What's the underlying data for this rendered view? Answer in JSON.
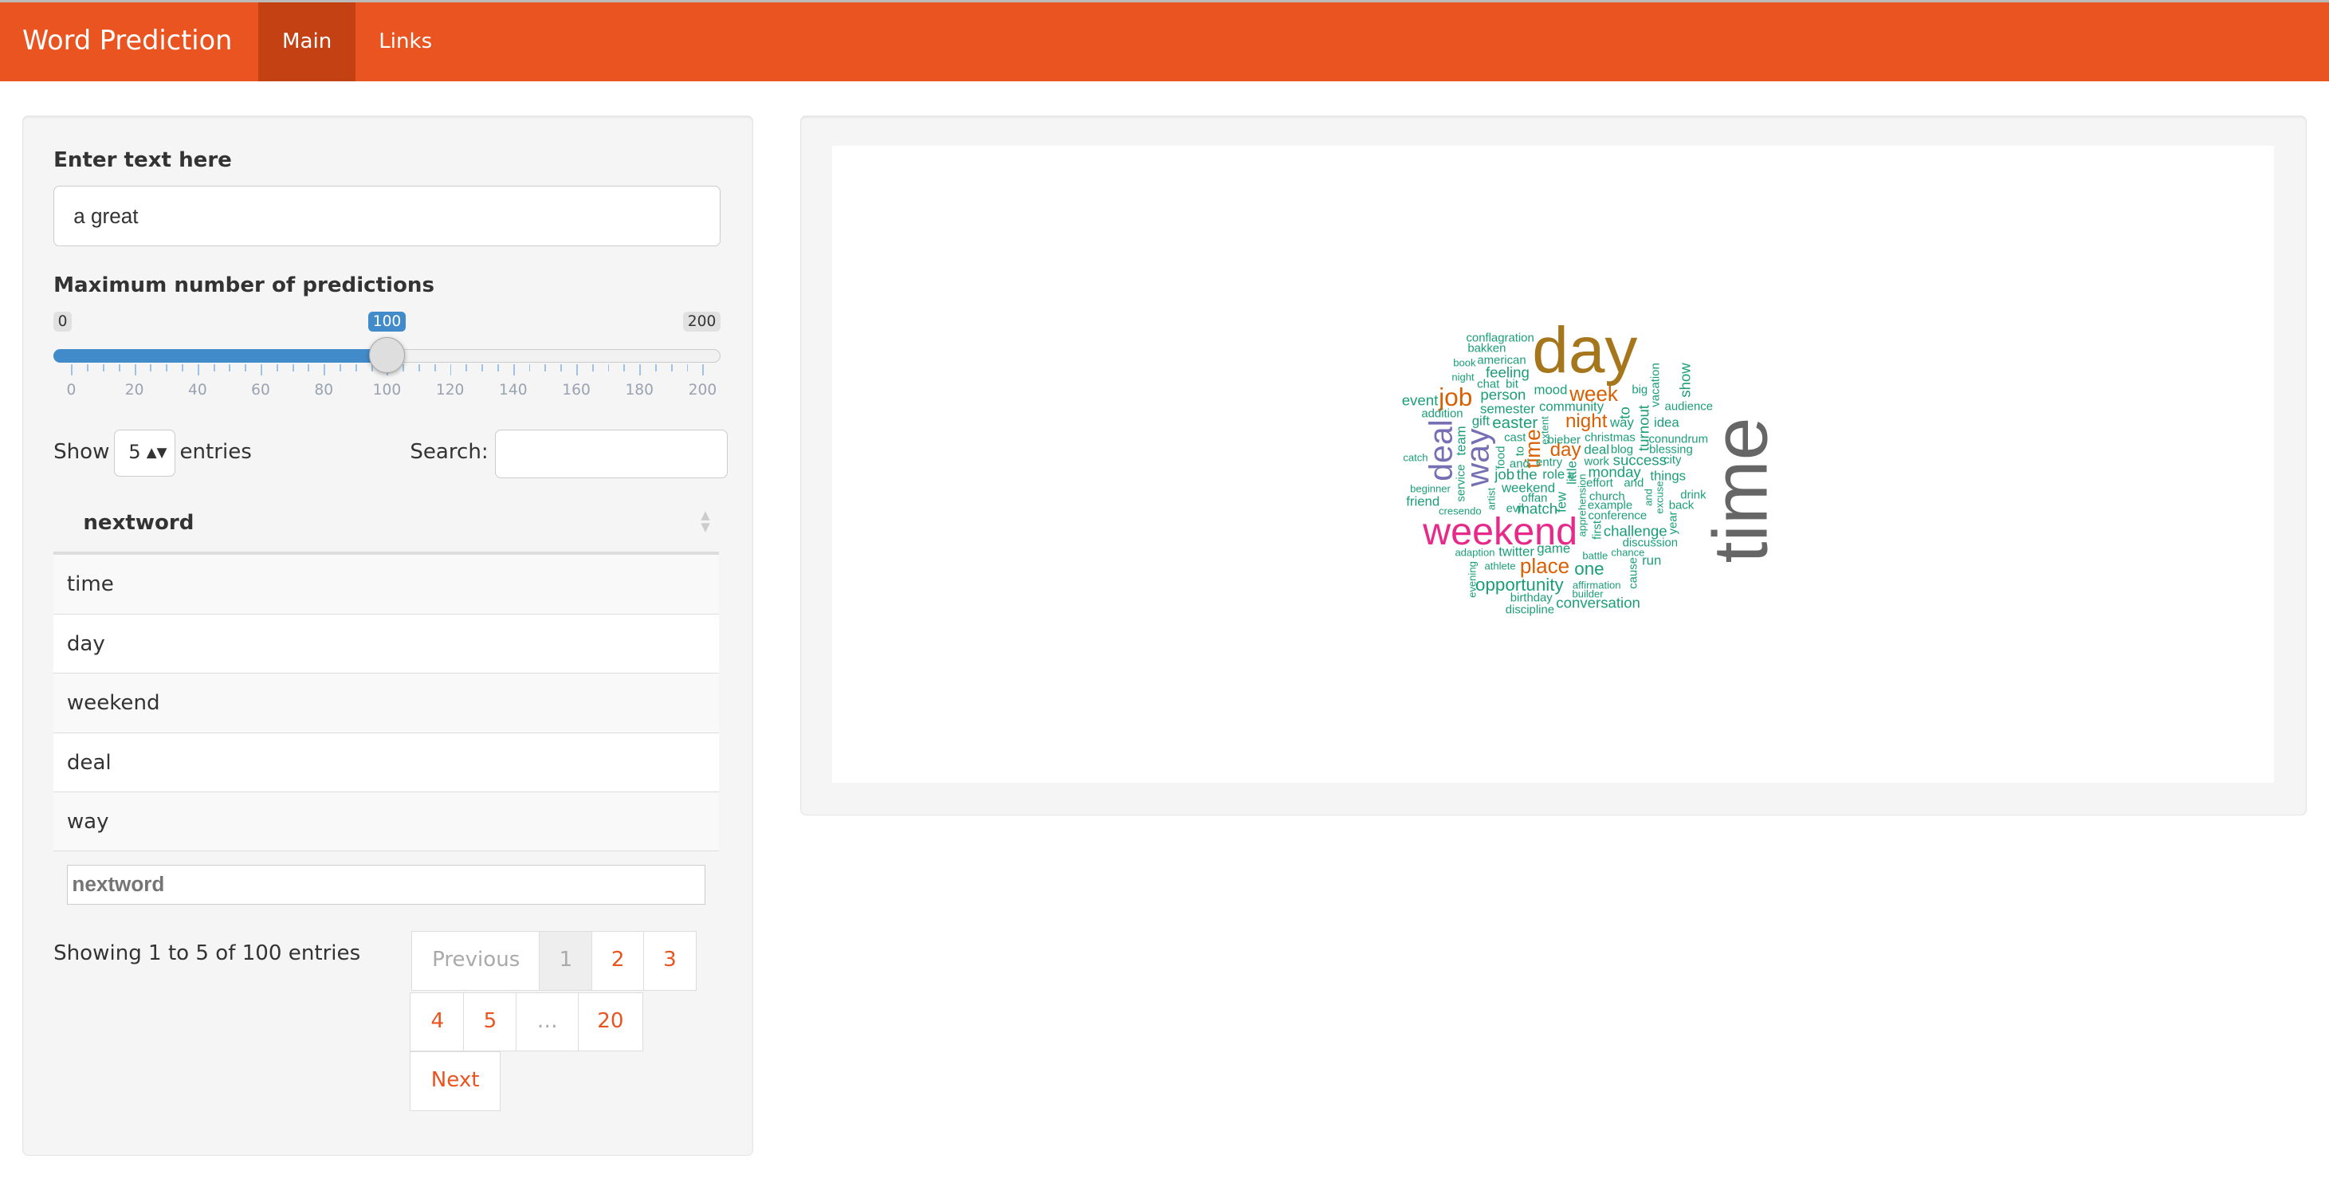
{
  "navbar": {
    "brand": "Word Prediction",
    "tabs": [
      {
        "label": "Main",
        "active": true
      },
      {
        "label": "Links",
        "active": false
      }
    ]
  },
  "input": {
    "label": "Enter text here",
    "value": "a great"
  },
  "slider": {
    "label": "Maximum number of predictions",
    "min": "0",
    "max": "200",
    "value": "100",
    "fraction": 0.5,
    "tick_labels": [
      "0",
      "20",
      "40",
      "60",
      "80",
      "100",
      "120",
      "140",
      "160",
      "180",
      "200"
    ]
  },
  "table": {
    "show_label": "Show",
    "length_value": "5",
    "entries_label": "entries",
    "search_label": "Search:",
    "search_value": "",
    "column": "nextword",
    "rows": [
      "time",
      "day",
      "weekend",
      "deal",
      "way"
    ],
    "filter_placeholder": "nextword",
    "info": "Showing 1 to 5 of 100 entries",
    "pagination": {
      "previous": "Previous",
      "pages": [
        "1",
        "2",
        "3",
        "4",
        "5",
        "…",
        "20"
      ],
      "next": "Next"
    }
  },
  "colors": {
    "accent": "#e95420",
    "green": "#1b9e77",
    "orange": "#d95f02",
    "purple": "#7570b3",
    "pink": "#e7298a",
    "olive": "#a6761d",
    "grey": "#666666"
  },
  "wordcloud": [
    "day",
    "time",
    "weekend",
    "deal",
    "way",
    "job",
    "week",
    "night",
    "day",
    "time",
    "place",
    "one",
    "opportunity",
    "conversation",
    "conflagration",
    "bakken",
    "book",
    "american",
    "feeling",
    "night",
    "chat",
    "bit",
    "person",
    "mood",
    "event",
    "community",
    "addition",
    "semester",
    "gift",
    "easter",
    "catch",
    "team",
    "service",
    "cast",
    "extent",
    "bieber",
    "to",
    "food",
    "and",
    "entry",
    "christmas",
    "deal",
    "blog",
    "work",
    "success",
    "city",
    "to",
    "way",
    "big",
    "turnout",
    "idea",
    "vacation",
    "show",
    "audience",
    "conundrum",
    "blessing",
    "job",
    "the",
    "role",
    "little",
    "monday",
    "things",
    "beginner",
    "weekend",
    "effort",
    "and",
    "a",
    "few",
    "friend",
    "artist",
    "offan",
    "apprehension",
    "church",
    "example",
    "and",
    "excuse",
    "drink",
    "back",
    "cresendo",
    "evil",
    "match",
    "conference",
    "first",
    "challenge",
    "year",
    "discussion",
    "adaption",
    "twitter",
    "game",
    "battle",
    "chance",
    "run",
    "cause",
    "athlete",
    "evening",
    "affirmation",
    "builder",
    "birthday",
    "discipline"
  ]
}
